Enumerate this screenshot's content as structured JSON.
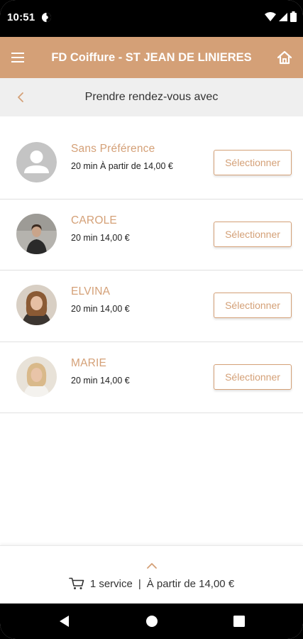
{
  "status_bar": {
    "time": "10:51"
  },
  "header": {
    "title": "FD Coiffure - ST JEAN DE LINIERES",
    "menu_icon": "hamburger-menu-icon",
    "home_icon": "home-icon"
  },
  "sub_header": {
    "title": "Prendre rendez-vous avec",
    "back_icon": "chevron-left-icon"
  },
  "staff": [
    {
      "name": "Sans Préférence",
      "info": "20 min À partir de 14,00 €",
      "button_label": "Sélectionner",
      "avatar": "default-user-avatar"
    },
    {
      "name": "CAROLE",
      "info": "20 min 14,00 €",
      "button_label": "Sélectionner",
      "avatar": "photo"
    },
    {
      "name": "ELVINA",
      "info": "20 min 14,00 €",
      "button_label": "Sélectionner",
      "avatar": "photo"
    },
    {
      "name": "MARIE",
      "info": "20 min 14,00 €",
      "button_label": "Sélectionner",
      "avatar": "photo"
    }
  ],
  "cart": {
    "count_label": "1 service",
    "separator": "|",
    "price_label": "À partir de 14,00 €"
  },
  "colors": {
    "accent": "#D4A077",
    "subheader_bg": "#efefef"
  }
}
